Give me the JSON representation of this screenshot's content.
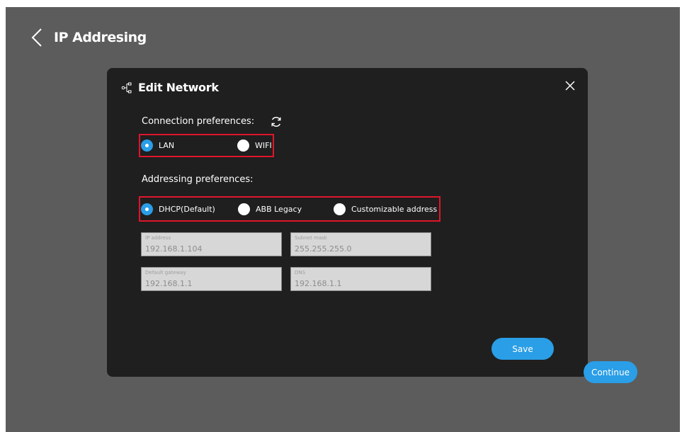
{
  "header": {
    "title": "IP Addresing"
  },
  "modal": {
    "title": "Edit Network",
    "connection": {
      "label": "Connection preferences:",
      "options": [
        {
          "label": "LAN",
          "selected": true
        },
        {
          "label": "WIFI",
          "selected": false
        }
      ]
    },
    "addressing": {
      "label": "Addressing preferences:",
      "options": [
        {
          "label": "DHCP(Default)",
          "selected": true
        },
        {
          "label": "ABB Legacy",
          "selected": false
        },
        {
          "label": "Customizable address",
          "selected": false
        }
      ]
    },
    "fields": {
      "ip_address": {
        "label": "IP address",
        "value": "192.168.1.104"
      },
      "subnet_mask": {
        "label": "Subnet mask",
        "value": "255.255.255.0"
      },
      "default_gateway": {
        "label": "Default gateway",
        "value": "192.168.1.1"
      },
      "dns": {
        "label": "DNS",
        "value": "192.168.1.1"
      }
    },
    "save_label": "Save"
  },
  "continue_label": "Continue",
  "colors": {
    "accent": "#2a9ee6",
    "highlight": "#e0152a",
    "modal_bg": "#1f1f1f",
    "screen_bg": "#5c5c5c"
  },
  "icons": {
    "back": "chevron-left-icon",
    "network": "network-icon",
    "close": "close-icon",
    "refresh": "refresh-icon"
  }
}
